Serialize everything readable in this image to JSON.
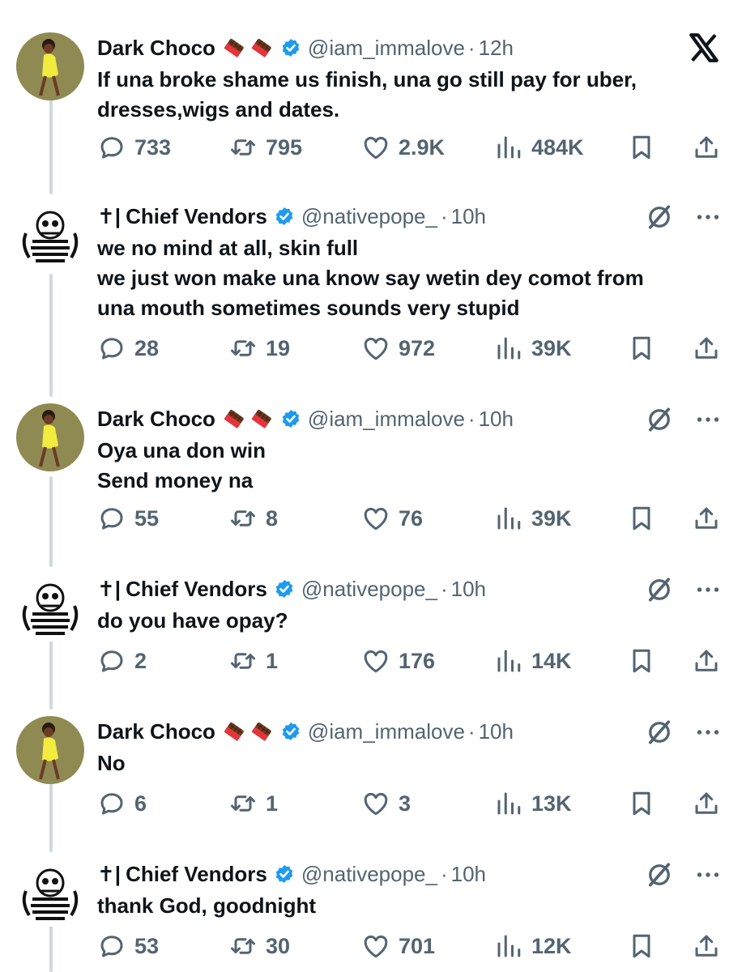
{
  "tweets": [
    {
      "name": "Dark Choco",
      "prefix": "",
      "handle": "@iam_immalove",
      "time": "12h",
      "lines": [
        "If una broke shame us finish, una go still pay for uber,",
        "dresses,wigs and dates."
      ],
      "replies": "733",
      "reposts": "795",
      "likes": "2.9K",
      "views": "484K",
      "corner": "x-logo"
    },
    {
      "name": "Chief Vendors",
      "prefix": "✝|",
      "handle": "@nativepope_",
      "time": "10h",
      "lines": [
        "we no mind at all, skin full",
        "we just won make una know say wetin dey comot from",
        "una mouth sometimes sounds very stupid"
      ],
      "replies": "28",
      "reposts": "19",
      "likes": "972",
      "views": "39K",
      "corner": "grok"
    },
    {
      "name": "Dark Choco",
      "prefix": "",
      "handle": "@iam_immalove",
      "time": "10h",
      "lines": [
        "Oya una don win",
        "Send money na"
      ],
      "replies": "55",
      "reposts": "8",
      "likes": "76",
      "views": "39K",
      "corner": "grok"
    },
    {
      "name": "Chief Vendors",
      "prefix": "✝|",
      "handle": "@nativepope_",
      "time": "10h",
      "lines": [
        "do you have opay?"
      ],
      "replies": "2",
      "reposts": "1",
      "likes": "176",
      "views": "14K",
      "corner": "grok"
    },
    {
      "name": "Dark Choco",
      "prefix": "",
      "handle": "@iam_immalove",
      "time": "10h",
      "lines": [
        "No"
      ],
      "replies": "6",
      "reposts": "1",
      "likes": "3",
      "views": "13K",
      "corner": "grok"
    },
    {
      "name": "Chief Vendors",
      "prefix": "✝|",
      "handle": "@nativepope_",
      "time": "10h",
      "lines": [
        "thank God, goodnight"
      ],
      "replies": "53",
      "reposts": "30",
      "likes": "701",
      "views": "12K",
      "corner": "grok"
    }
  ],
  "icons": {
    "reply": "reply-icon",
    "repost": "repost-icon",
    "like": "heart-icon",
    "views": "views-icon",
    "bookmark": "bookmark-icon",
    "share": "share-icon",
    "more": "more-icon",
    "verified": "verified-badge-icon",
    "emoji": "chocolate-bar-emoji"
  },
  "colors": {
    "text": "#0f1419",
    "muted": "#536471",
    "verified": "#1d9bf0",
    "thread": "#cfd9de"
  }
}
